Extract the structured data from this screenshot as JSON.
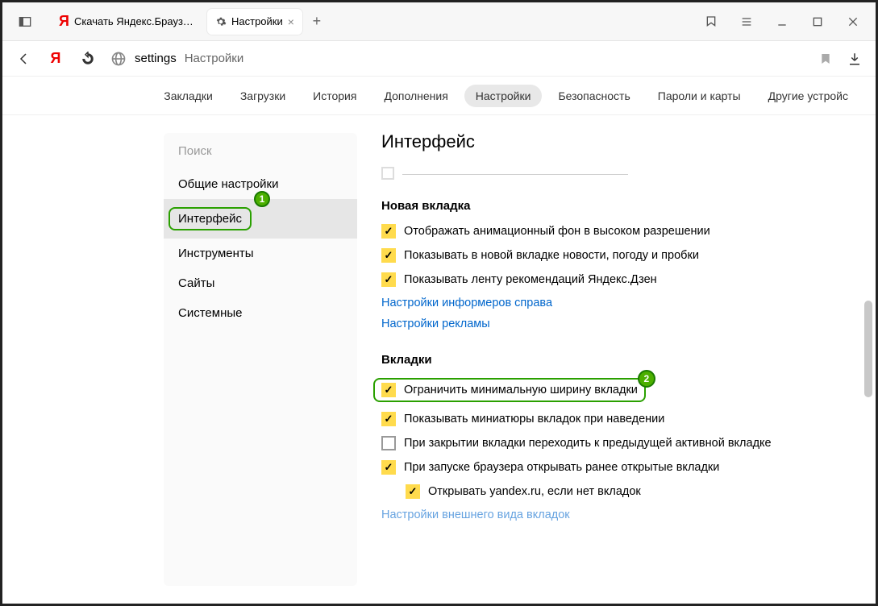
{
  "titlebar": {
    "tab1_title": "Скачать Яндекс.Браузер д",
    "tab2_title": "Настройки"
  },
  "addr": {
    "host": "settings",
    "path": "Настройки"
  },
  "nav": {
    "bookmarks": "Закладки",
    "downloads": "Загрузки",
    "history": "История",
    "addons": "Дополнения",
    "settings": "Настройки",
    "security": "Безопасность",
    "passwords": "Пароли и карты",
    "other": "Другие устройс"
  },
  "sidebar": {
    "search_placeholder": "Поиск",
    "items": [
      "Общие настройки",
      "Интерфейс",
      "Инструменты",
      "Сайты",
      "Системные"
    ]
  },
  "main": {
    "heading": "Интерфейс",
    "section_newtab": {
      "title": "Новая вкладка",
      "opt1": "Отображать анимационный фон в высоком разрешении",
      "opt2": "Показывать в новой вкладке новости, погоду и пробки",
      "opt3": "Показывать ленту рекомендаций Яндекс.Дзен",
      "link1": "Настройки информеров справа",
      "link2": "Настройки рекламы"
    },
    "section_tabs": {
      "title": "Вкладки",
      "opt1": "Ограничить минимальную ширину вкладки",
      "opt2": "Показывать миниатюры вкладок при наведении",
      "opt3": "При закрытии вкладки переходить к предыдущей активной вкладке",
      "opt4": "При запуске браузера открывать ранее открытые вкладки",
      "opt4_sub": "Открывать yandex.ru, если нет вкладок",
      "link_truncated": "Настройки внешнего вида вкладок"
    }
  },
  "badges": {
    "b1": "1",
    "b2": "2"
  }
}
